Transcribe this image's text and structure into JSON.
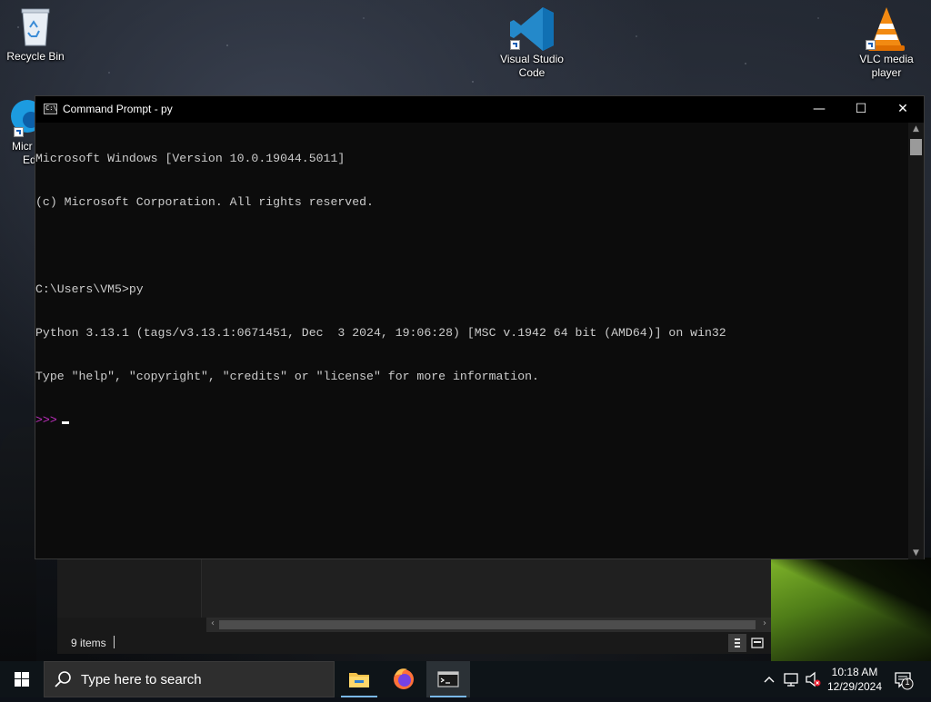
{
  "desktop": {
    "icons": [
      {
        "label": "Recycle Bin",
        "icon": "recycle-bin-icon"
      },
      {
        "label": "Visual Studio Code",
        "line1": "Visual Studio",
        "line2": "Code",
        "icon": "vscode-icon"
      },
      {
        "label": "VLC media player",
        "line1": "VLC media",
        "line2": "player",
        "icon": "vlc-icon"
      },
      {
        "label": "Microsoft Edge",
        "line1": "Micr",
        "line2": "Ed",
        "icon": "edge-icon"
      }
    ]
  },
  "cmd": {
    "title": "Command Prompt - py",
    "lines": [
      "Microsoft Windows [Version 10.0.19044.5011]",
      "(c) Microsoft Corporation. All rights reserved.",
      "",
      "C:\\Users\\VM5>py",
      "Python 3.13.1 (tags/v3.13.1:0671451, Dec  3 2024, 19:06:28) [MSC v.1942 64 bit (AMD64)] on win32",
      "Type \"help\", \"copyright\", \"credits\" or \"license\" for more information."
    ],
    "prompt": ">>>",
    "minimize_glyph": "—",
    "maximize_glyph": "☐",
    "close_glyph": "✕"
  },
  "explorer": {
    "status_items": "9 items"
  },
  "taskbar": {
    "search_placeholder": "Type here to search",
    "apps": [
      {
        "name": "File Explorer",
        "icon": "file-explorer-icon"
      },
      {
        "name": "Firefox",
        "icon": "firefox-icon"
      },
      {
        "name": "Command Prompt",
        "icon": "cmd-icon",
        "active": true
      }
    ],
    "clock_time": "10:18 AM",
    "clock_date": "12/29/2024",
    "notification_count": "1"
  },
  "colors": {
    "console_bg": "#0c0c0c",
    "console_text": "#cccccc",
    "prompt": "#c02fc0",
    "taskbar": "#0e1418"
  }
}
